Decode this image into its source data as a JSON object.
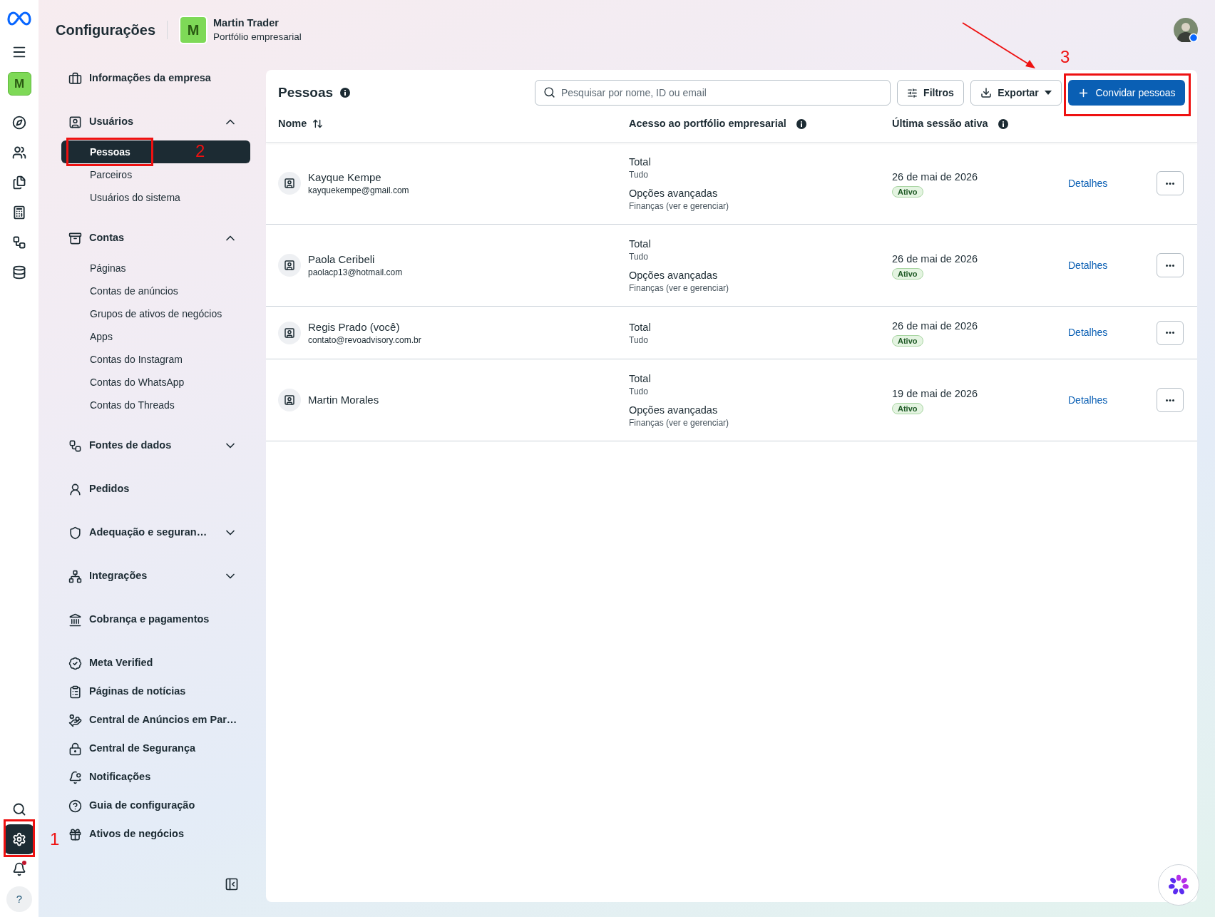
{
  "rail": {
    "top": [
      {
        "kind": "logo"
      },
      {
        "kind": "menu"
      },
      {
        "kind": "avatar",
        "initial": "M"
      },
      {
        "kind": "icon",
        "selected": false
      },
      {
        "kind": "icon",
        "selected": false
      },
      {
        "kind": "icon",
        "selected": false
      },
      {
        "kind": "icon",
        "selected": false
      },
      {
        "kind": "icon",
        "selected": false
      },
      {
        "kind": "icon",
        "selected": false
      }
    ],
    "bottom": [
      {
        "kind": "icon",
        "selected": false
      },
      {
        "kind": "icon",
        "selected": true
      },
      {
        "kind": "icon",
        "selected": false,
        "badge": true
      },
      {
        "kind": "help",
        "label": "?"
      }
    ]
  },
  "header": {
    "title": "Configurações",
    "portfolio": {
      "initial": "M",
      "name": "Martin Trader",
      "subtitle": "Portfólio empresarial"
    }
  },
  "sidebar": {
    "items": [
      {
        "kind": "section",
        "label": "Informações da empresa"
      },
      {
        "kind": "group",
        "label": "Usuários",
        "expanded": true,
        "children": [
          {
            "label": "Pessoas",
            "selected": true
          },
          {
            "label": "Parceiros",
            "selected": false
          },
          {
            "label": "Usuários do sistema",
            "selected": false
          }
        ]
      },
      {
        "kind": "group",
        "label": "Contas",
        "expanded": true,
        "children": [
          {
            "label": "Páginas",
            "selected": false
          },
          {
            "label": "Contas de anúncios",
            "selected": false
          },
          {
            "label": "Grupos de ativos de negócios",
            "selected": false
          },
          {
            "label": "Apps",
            "selected": false
          },
          {
            "label": "Contas do Instagram",
            "selected": false
          },
          {
            "label": "Contas do WhatsApp",
            "selected": false
          },
          {
            "label": "Contas do Threads",
            "selected": false
          }
        ]
      },
      {
        "kind": "group",
        "label": "Fontes de dados",
        "expanded": false
      },
      {
        "kind": "section",
        "label": "Pedidos"
      },
      {
        "kind": "group",
        "label": "Adequação e seguran…",
        "expanded": false
      },
      {
        "kind": "group",
        "label": "Integrações",
        "expanded": false
      },
      {
        "kind": "section",
        "label": "Cobrança e pagamentos"
      },
      {
        "kind": "section",
        "label": "Meta Verified"
      },
      {
        "kind": "link",
        "label": "Páginas de notícias"
      },
      {
        "kind": "link",
        "label": "Central de Anúncios em Par…"
      },
      {
        "kind": "link",
        "label": "Central de Segurança"
      },
      {
        "kind": "link",
        "label": "Notificações"
      },
      {
        "kind": "link",
        "label": "Guia de configuração"
      },
      {
        "kind": "link",
        "label": "Ativos de negócios"
      }
    ]
  },
  "people_panel": {
    "title": "Pessoas",
    "search": {
      "placeholder": "Pesquisar por nome, ID ou email"
    },
    "filters_button": "Filtros",
    "export_button": "Exportar",
    "invite_button": "Convidar pessoas",
    "columns": [
      {
        "label": "Nome",
        "sortable": true,
        "info": false
      },
      {
        "label": "Acesso ao portfólio empresarial",
        "sortable": false,
        "info": true
      },
      {
        "label": "Última sessão ativa",
        "sortable": false,
        "info": true
      }
    ],
    "rows": [
      {
        "name": "Kayque Kempe",
        "email": "kayquekempe@gmail.com",
        "access": [
          {
            "title": "Total",
            "detail": "Tudo"
          },
          {
            "title": "Opções avançadas",
            "detail": "Finanças (ver e gerenciar)"
          }
        ],
        "last_session": "26 de mai de 2026",
        "status": "Ativo",
        "details": "Detalhes"
      },
      {
        "name": "Paola Ceribeli",
        "email": "paolacp13@hotmail.com",
        "access": [
          {
            "title": "Total",
            "detail": "Tudo"
          },
          {
            "title": "Opções avançadas",
            "detail": "Finanças (ver e gerenciar)"
          }
        ],
        "last_session": "26 de mai de 2026",
        "status": "Ativo",
        "details": "Detalhes"
      },
      {
        "name": "Regis Prado (você)",
        "email": "contato@revoadvisory.com.br",
        "access": [
          {
            "title": "Total",
            "detail": "Tudo"
          }
        ],
        "last_session": "26 de mai de 2026",
        "status": "Ativo",
        "details": "Detalhes"
      },
      {
        "name": "Martin Morales",
        "access": [
          {
            "title": "Total",
            "detail": "Tudo"
          },
          {
            "title": "Opções avançadas",
            "detail": "Finanças (ver e gerenciar)"
          }
        ],
        "last_session": "19 de mai de 2026",
        "status": "Ativo",
        "details": "Detalhes"
      }
    ]
  },
  "annotations": [
    {
      "kind": "frame",
      "number": "1"
    },
    {
      "kind": "frame",
      "number": "2"
    },
    {
      "kind": "frame",
      "number": "3"
    },
    {
      "kind": "arrow"
    }
  ]
}
